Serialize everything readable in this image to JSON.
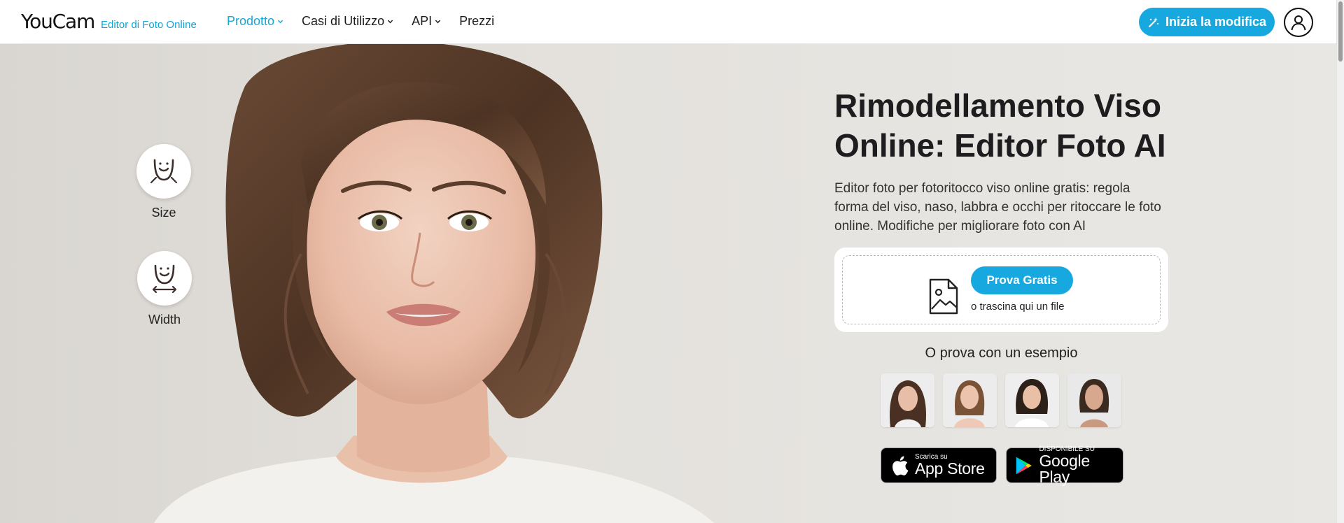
{
  "header": {
    "logo": "YouCam",
    "logo_sub": "Editor di Foto Online",
    "nav": [
      {
        "label": "Prodotto",
        "has_dropdown": true,
        "active": true
      },
      {
        "label": "Casi di Utilizzo",
        "has_dropdown": true,
        "active": false
      },
      {
        "label": "API",
        "has_dropdown": true,
        "active": false
      },
      {
        "label": "Prezzi",
        "has_dropdown": false,
        "active": false
      }
    ],
    "cta_label": "Inizia la modifica",
    "cta_icon": "magic-wand-icon",
    "user_icon": "user-icon"
  },
  "hero": {
    "features": [
      {
        "label": "Size",
        "icon": "face-size-icon"
      },
      {
        "label": "Width",
        "icon": "face-width-icon"
      }
    ],
    "title": "Rimodellamento Viso Online: Editor Foto AI",
    "description": "Editor foto per fotoritocco viso online gratis: regola forma del viso, naso, labbra e occhi per ritoccare le foto online. Modifiche per migliorare foto con AI",
    "upload": {
      "button_label": "Prova Gratis",
      "drop_text": "o trascina qui un file",
      "icon": "image-file-icon"
    },
    "example_title": "O prova con un esempio",
    "stores": {
      "apple_small": "Scarica su",
      "apple_big": "App Store",
      "google_small": "DISPONIBILE SU",
      "google_big": "Google Play"
    }
  },
  "colors": {
    "accent": "#17a8e0",
    "nav_active": "#17a8d8",
    "hero_bg": "#e4e1dc"
  }
}
